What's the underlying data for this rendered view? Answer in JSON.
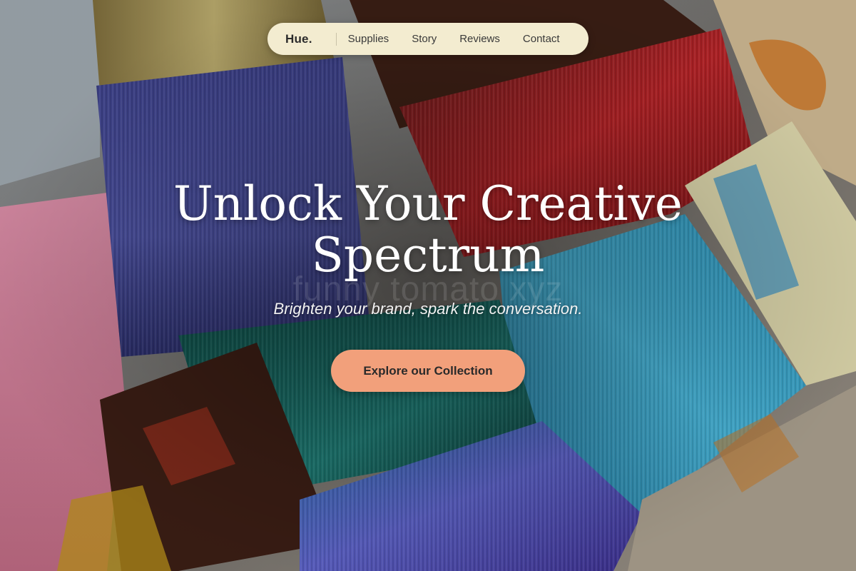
{
  "nav": {
    "brand": "Hue.",
    "links": [
      {
        "label": "Supplies"
      },
      {
        "label": "Story"
      },
      {
        "label": "Reviews"
      },
      {
        "label": "Contact"
      }
    ]
  },
  "hero": {
    "headline_line1": "Unlock Your Creative",
    "headline_line2": "Spectrum",
    "subheadline": "Brighten your brand, spark the conversation.",
    "watermark": "funny tomato xyz",
    "cta_label": "Explore our Collection"
  },
  "colors": {
    "nav_bg": "#f3ecd0",
    "cta_bg": "#f2a07b",
    "headline": "#ffffff"
  }
}
